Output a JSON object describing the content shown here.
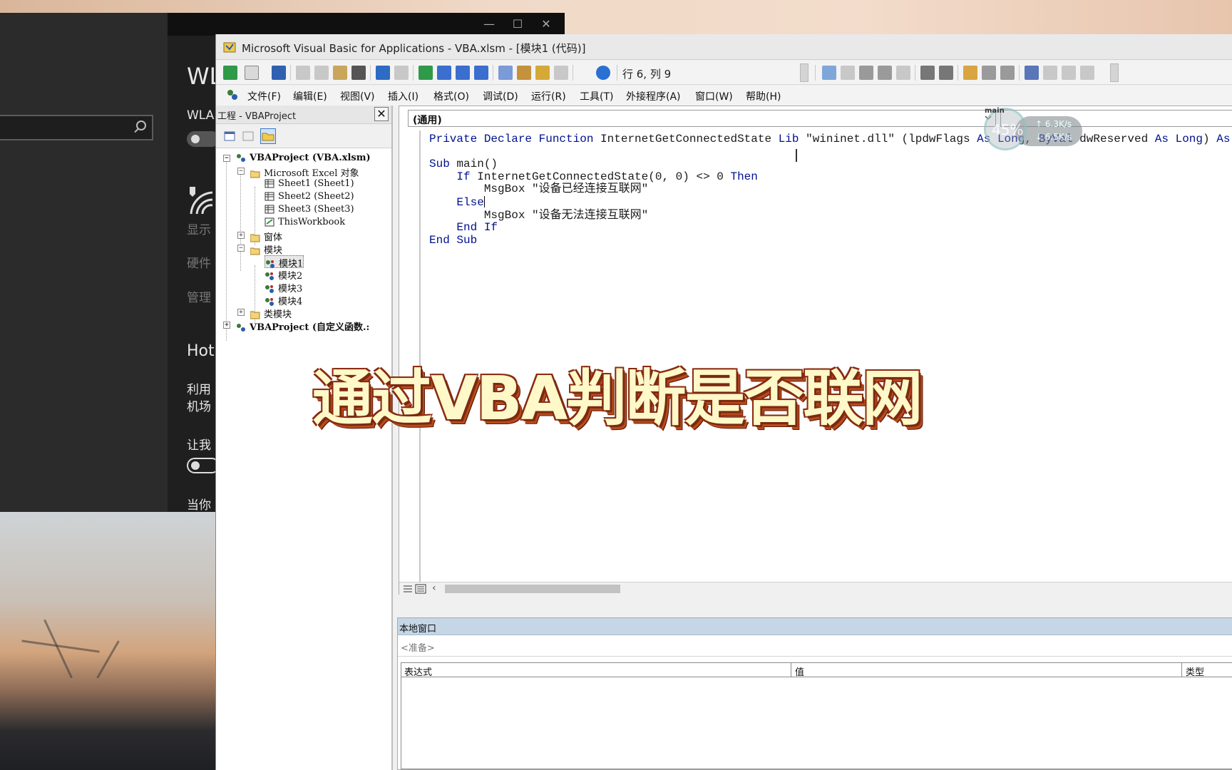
{
  "settings": {
    "title_partial": "WL",
    "wlan_partial": "WLA",
    "display_partial": "显示",
    "hardware_partial": "硬件",
    "manage_partial": "管理",
    "hotspot_partial": "Hot",
    "use_partial_1": "利用",
    "use_partial_2": "机场",
    "let_partial": "让我",
    "when_partial": "当你"
  },
  "vbe": {
    "title": "Microsoft Visual Basic for Applications - VBA.xlsm - [模块1 (代码)]",
    "cursor_position": "行 6, 列 9",
    "menu": [
      "文件(F)",
      "编辑(E)",
      "视图(V)",
      "插入(I)",
      "格式(O)",
      "调试(D)",
      "运行(R)",
      "工具(T)",
      "外接程序(A)",
      "窗口(W)",
      "帮助(H)"
    ],
    "project": {
      "header": "工程 - VBAProject",
      "close": "✕",
      "root": "VBAProject (VBA.xlsm)",
      "excel_objects": "Microsoft Excel 对象",
      "sheets": [
        "Sheet1 (Sheet1)",
        "Sheet2 (Sheet2)",
        "Sheet3 (Sheet3)"
      ],
      "workbook": "ThisWorkbook",
      "forms": "窗体",
      "modules": "模块",
      "module_items": [
        "模块1",
        "模块2",
        "模块3",
        "模块4"
      ],
      "class_modules": "类模块",
      "root2": "VBAProject (自定义函数.:"
    },
    "code": {
      "object_combo": "(通用)",
      "proc_combo": "main",
      "lines": [
        "Private Declare Function InternetGetConnectedState Lib \"wininet.dll\" (lpdwFlags As Long, ByVal dwReserved As Long) As",
        "",
        "Sub main()",
        "    If InternetGetConnectedState(0, 0) <> 0 Then",
        "        MsgBox \"设备已经连接互联网\"",
        "    Else",
        "        MsgBox \"设备无法连接互联网\"",
        "    End If",
        "End Sub"
      ]
    },
    "locals": {
      "header": "本地窗口",
      "status": "<准备>",
      "columns": [
        "表达式",
        "值",
        "类型"
      ]
    }
  },
  "net_widget": {
    "percent": "45%",
    "up": "↑ 6.3K/s",
    "down": "↓ 6.5K/s"
  },
  "subtitle": "通过VBA判断是否联网",
  "colors": {
    "keyword": "#00108f",
    "subtitle_fill": "#fff8c8",
    "subtitle_stroke": "#7a2a10"
  }
}
